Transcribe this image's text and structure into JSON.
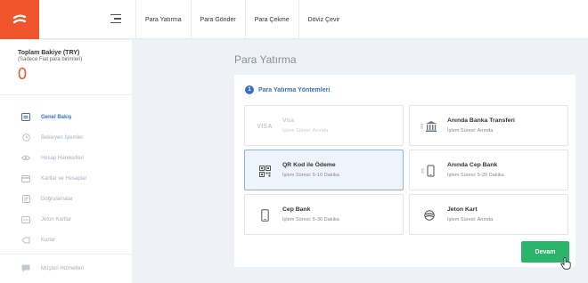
{
  "topnav": {
    "items": [
      {
        "label": "Para Yatırma"
      },
      {
        "label": "Para Gönder"
      },
      {
        "label": "Para Çekme"
      },
      {
        "label": "Döviz Çevir"
      }
    ]
  },
  "sidebar": {
    "balance_title": "Toplam Bakiye (TRY)",
    "balance_subtitle": "(Sadece Fiat para birimleri)",
    "balance_value": "0",
    "items": [
      {
        "label": "Genel Bakış",
        "icon": "dashboard-icon",
        "active": true
      },
      {
        "label": "Bekleyen İşlemler",
        "icon": "clock-icon"
      },
      {
        "label": "Hesap Hareketleri",
        "icon": "eye-icon"
      },
      {
        "label": "Kartlar ve Hesaplar",
        "icon": "card-icon"
      },
      {
        "label": "Doğrulamalar",
        "icon": "document-icon"
      },
      {
        "label": "Jeton Kartlar",
        "icon": "token-card-icon"
      },
      {
        "label": "Kurlar",
        "icon": "tag-icon"
      },
      {
        "label": "Müşteri Hizmetleri",
        "icon": "chat-icon"
      }
    ]
  },
  "main": {
    "page_title": "Para Yatırma",
    "step_number": "1",
    "step_title": "Para Yatırma Yöntemleri",
    "methods": [
      {
        "title": "Visa",
        "subtitle": "İşlem Süresi: Anında",
        "icon": "visa-icon",
        "state": "disabled"
      },
      {
        "title": "Anında Banka Transferi",
        "subtitle": "İşlem Süresi: Anında",
        "icon": "bank-icon",
        "state": "normal"
      },
      {
        "title": "QR Kod ile Ödeme",
        "subtitle": "İşlem Süresi: 5-10 Dakika",
        "icon": "qr-code-icon",
        "state": "selected"
      },
      {
        "title": "Anında Cep Bank",
        "subtitle": "İşlem Süresi: 5-20 Dakika",
        "icon": "mobile-transfer-icon",
        "state": "normal"
      },
      {
        "title": "Cep Bank",
        "subtitle": "İşlem Süresi: 5-30 Dakika",
        "icon": "phone-icon",
        "state": "normal"
      },
      {
        "title": "Jeton Kart",
        "subtitle": "İşlem Süresi: Anında",
        "icon": "jeton-icon",
        "state": "normal"
      }
    ],
    "visa_logo_text": "VISA",
    "continue_label": "Devam"
  },
  "colors": {
    "brand": "#f0542a",
    "accent": "#3a6fc9",
    "success": "#2ab56b"
  }
}
